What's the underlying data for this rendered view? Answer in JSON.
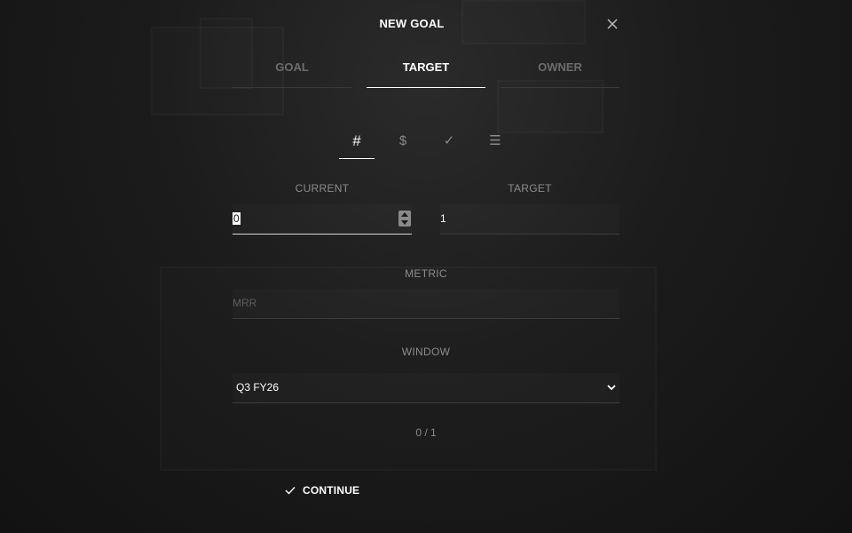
{
  "modal": {
    "title": "NEW GOAL",
    "close_icon": "close-icon"
  },
  "tabs": [
    {
      "label": "GOAL",
      "active": false
    },
    {
      "label": "TARGET",
      "active": true
    },
    {
      "label": "OWNER",
      "active": false
    }
  ],
  "target_types": [
    {
      "icon": "hash-icon",
      "glyph": "#",
      "active": true
    },
    {
      "icon": "dollar-icon",
      "glyph": "$",
      "active": false
    },
    {
      "icon": "check-icon",
      "glyph": "✓",
      "active": false
    },
    {
      "icon": "list-icon",
      "glyph": "☰",
      "active": false
    }
  ],
  "current": {
    "label": "CURRENT",
    "value": "0"
  },
  "target": {
    "label": "TARGET",
    "value": "1"
  },
  "metric": {
    "label": "METRIC",
    "value": "",
    "placeholder": "MRR"
  },
  "window": {
    "label": "WINDOW",
    "selected": "Q3 FY26"
  },
  "progress": {
    "text": "0 / 1"
  },
  "continue": {
    "label": "CONTINUE",
    "icon": "check-icon"
  },
  "colors": {
    "background": "#141414",
    "text": "#ffffff",
    "muted": "#8c8c8c"
  }
}
